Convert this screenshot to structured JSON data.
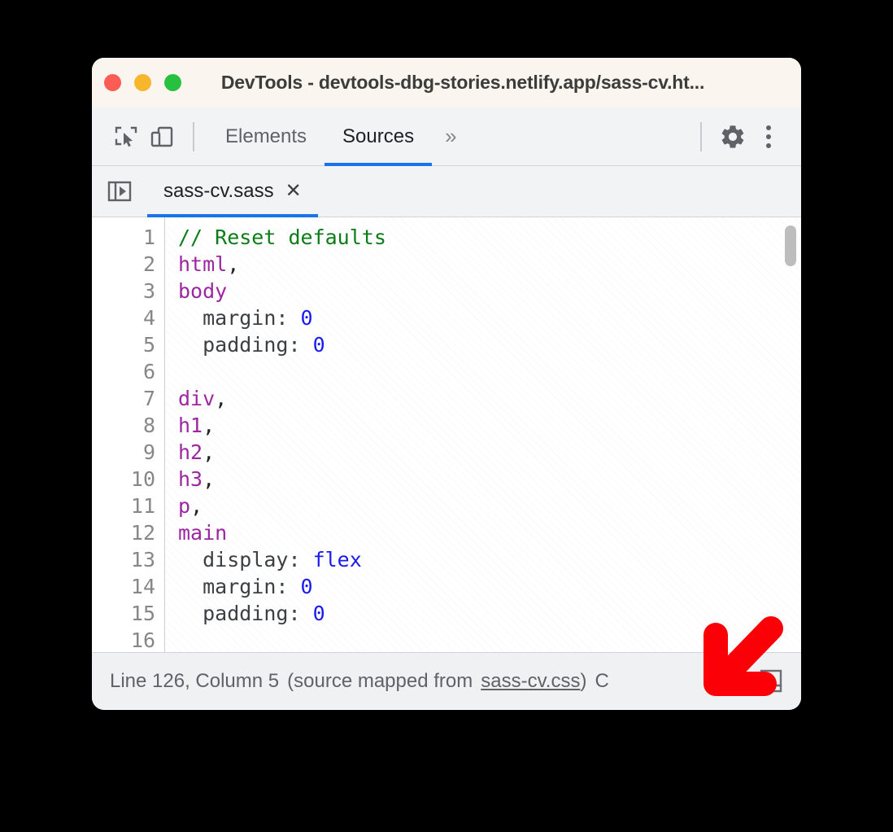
{
  "window": {
    "title": "DevTools - devtools-dbg-stories.netlify.app/sass-cv.ht...",
    "traffic_lights": [
      {
        "name": "close",
        "color": "#FB5C54"
      },
      {
        "name": "minimize",
        "color": "#F8B62C"
      },
      {
        "name": "zoom",
        "color": "#28C13F"
      }
    ]
  },
  "toolbar": {
    "inspect_icon": "inspect-element-icon",
    "device_icon": "device-toolbar-icon",
    "tabs": [
      {
        "label": "Elements",
        "active": false
      },
      {
        "label": "Sources",
        "active": true
      }
    ],
    "more_tabs": "»",
    "settings_icon": "gear-icon",
    "menu_icon": "kebab-menu-icon",
    "accent_color": "#1A73E8"
  },
  "filebar": {
    "navigator_toggle_icon": "show-navigator-icon",
    "tabs": [
      {
        "name": "sass-cv.sass",
        "close": "✕",
        "active": true
      }
    ]
  },
  "editor": {
    "line_numbers": [
      "1",
      "2",
      "3",
      "4",
      "5",
      "6",
      "7",
      "8",
      "9",
      "10",
      "11",
      "12",
      "13",
      "14",
      "15",
      "16"
    ],
    "lines": [
      {
        "n": 1,
        "tokens": [
          {
            "t": "// Reset defaults",
            "c": "tok-comment"
          }
        ]
      },
      {
        "n": 2,
        "tokens": [
          {
            "t": "html",
            "c": "tok-tag"
          },
          {
            "t": ",",
            "c": "tok-punct"
          }
        ]
      },
      {
        "n": 3,
        "tokens": [
          {
            "t": "body",
            "c": "tok-tag"
          }
        ]
      },
      {
        "n": 4,
        "tokens": [
          {
            "t": "  margin: ",
            "c": "tok-prop"
          },
          {
            "t": "0",
            "c": "tok-val"
          }
        ]
      },
      {
        "n": 5,
        "tokens": [
          {
            "t": "  padding: ",
            "c": "tok-prop"
          },
          {
            "t": "0",
            "c": "tok-val"
          }
        ]
      },
      {
        "n": 6,
        "tokens": [
          {
            "t": "",
            "c": "tok-punct"
          }
        ]
      },
      {
        "n": 7,
        "tokens": [
          {
            "t": "div",
            "c": "tok-tag"
          },
          {
            "t": ",",
            "c": "tok-punct"
          }
        ]
      },
      {
        "n": 8,
        "tokens": [
          {
            "t": "h1",
            "c": "tok-tag"
          },
          {
            "t": ",",
            "c": "tok-punct"
          }
        ]
      },
      {
        "n": 9,
        "tokens": [
          {
            "t": "h2",
            "c": "tok-tag"
          },
          {
            "t": ",",
            "c": "tok-punct"
          }
        ]
      },
      {
        "n": 10,
        "tokens": [
          {
            "t": "h3",
            "c": "tok-tag"
          },
          {
            "t": ",",
            "c": "tok-punct"
          }
        ]
      },
      {
        "n": 11,
        "tokens": [
          {
            "t": "p",
            "c": "tok-tag"
          },
          {
            "t": ",",
            "c": "tok-punct"
          }
        ]
      },
      {
        "n": 12,
        "tokens": [
          {
            "t": "main",
            "c": "tok-tag"
          }
        ]
      },
      {
        "n": 13,
        "tokens": [
          {
            "t": "  display: ",
            "c": "tok-prop"
          },
          {
            "t": "flex",
            "c": "tok-val"
          }
        ]
      },
      {
        "n": 14,
        "tokens": [
          {
            "t": "  margin: ",
            "c": "tok-prop"
          },
          {
            "t": "0",
            "c": "tok-val"
          }
        ]
      },
      {
        "n": 15,
        "tokens": [
          {
            "t": "  padding: ",
            "c": "tok-prop"
          },
          {
            "t": "0",
            "c": "tok-val"
          }
        ]
      },
      {
        "n": 16,
        "tokens": [
          {
            "t": "",
            "c": "tok-punct"
          }
        ]
      }
    ],
    "syntax_colors": {
      "comment": "#0B7C18",
      "selector": "#9C27A0",
      "property": "#3C4043",
      "value": "#1A1AEF"
    }
  },
  "status": {
    "position": "Line 126, Column 5",
    "source_map_prefix": "(source mapped from",
    "source_map_file": "sass-cv.css",
    "source_map_suffix": ")",
    "truncated_tail": "C",
    "pretty_print_icon": "pretty-print-icon"
  },
  "annotation": {
    "arrow": "red-arrow-down-left",
    "color": "#FB0007"
  }
}
